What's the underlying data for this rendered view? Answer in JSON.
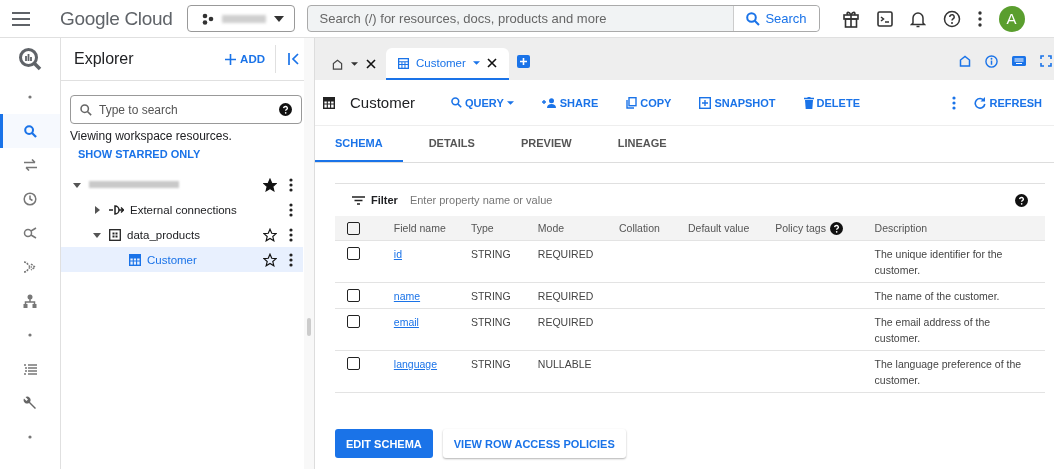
{
  "top_bar": {
    "logo": "Google Cloud",
    "search": {
      "placeholder": "Search (/) for resources, docs, products and more",
      "button": "Search"
    },
    "avatar": "A"
  },
  "rail": [
    {
      "kind": "logo",
      "selected": false
    },
    {
      "kind": "dot",
      "selected": false
    },
    {
      "kind": "search",
      "selected": true
    },
    {
      "kind": "transfer",
      "selected": false
    },
    {
      "kind": "history",
      "selected": false
    },
    {
      "kind": "pipeline",
      "selected": false
    },
    {
      "kind": "merge",
      "selected": false
    },
    {
      "kind": "hierarchy",
      "selected": false
    },
    {
      "kind": "dot",
      "selected": false
    },
    {
      "kind": "list",
      "selected": false
    },
    {
      "kind": "wrench",
      "selected": false
    },
    {
      "kind": "dot",
      "selected": false
    }
  ],
  "explorer": {
    "title": "Explorer",
    "add": "ADD",
    "search": {
      "placeholder": "Type to search"
    },
    "info": "Viewing workspace resources.",
    "link": "SHOW STARRED ONLY",
    "tree": [
      {
        "kind": "project",
        "expanded": true,
        "starred": true,
        "selected": false,
        "children": [
          {
            "kind": "connection",
            "name": "External connections",
            "expanded": false,
            "selected": false
          },
          {
            "kind": "dataset",
            "name": "data_products",
            "expanded": true,
            "starred": false,
            "selected": false,
            "children": [
              {
                "kind": "table",
                "name": "Customer",
                "starred": false,
                "selected": true
              }
            ]
          }
        ]
      }
    ]
  },
  "editor_tabs": [
    {
      "kind": "home",
      "selected": false
    },
    {
      "kind": "table",
      "label": "Customer",
      "selected": true
    }
  ],
  "toolbar": {
    "title": "Customer",
    "actions": [
      {
        "kind": "query",
        "label": "QUERY"
      },
      {
        "kind": "share",
        "label": "SHARE"
      },
      {
        "kind": "copy",
        "label": "COPY"
      },
      {
        "kind": "snapshot",
        "label": "SNAPSHOT"
      },
      {
        "kind": "delete",
        "label": "DELETE"
      }
    ],
    "refresh": "REFRESH"
  },
  "sub_tabs": [
    {
      "label": "SCHEMA",
      "selected": true
    },
    {
      "label": "DETAILS",
      "selected": false
    },
    {
      "label": "PREVIEW",
      "selected": false
    },
    {
      "label": "LINEAGE",
      "selected": false
    }
  ],
  "schema": {
    "filter": "Filter",
    "filter_placeholder": "Enter property name or value",
    "header_checked": false,
    "columns": [
      "Field name",
      "Type",
      "Mode",
      "Collation",
      "Default value",
      "Policy tags",
      "Description"
    ],
    "rows": [
      {
        "checked": false,
        "field": "id",
        "type": "STRING",
        "mode": "REQUIRED",
        "description": "The unique identifier for the customer."
      },
      {
        "checked": false,
        "field": "name",
        "type": "STRING",
        "mode": "REQUIRED",
        "description": "The name of the customer."
      },
      {
        "checked": false,
        "field": "email",
        "type": "STRING",
        "mode": "REQUIRED",
        "description": "The email address of the customer."
      },
      {
        "checked": false,
        "field": "language",
        "type": "STRING",
        "mode": "NULLABLE",
        "description": "The language preference of the customer."
      }
    ]
  },
  "buttons": [
    {
      "kind": "primary",
      "label": "EDIT SCHEMA"
    },
    {
      "kind": "secondary",
      "label": "VIEW ROW ACCESS POLICIES"
    }
  ]
}
